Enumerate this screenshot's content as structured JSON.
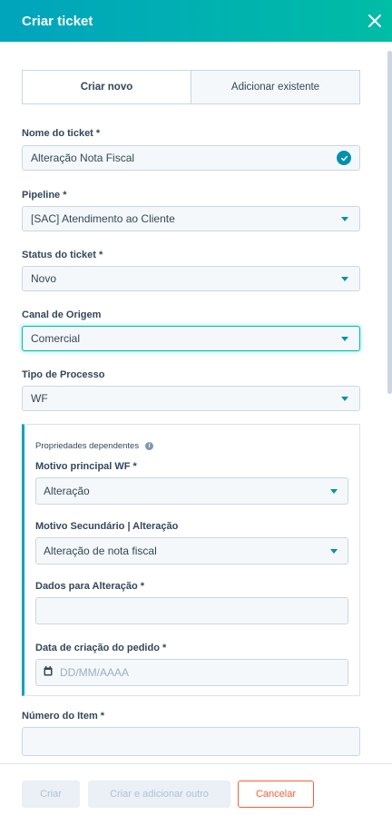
{
  "header": {
    "title": "Criar ticket",
    "close_icon": "close-icon"
  },
  "tabs": [
    {
      "label": "Criar novo",
      "active": true
    },
    {
      "label": "Adicionar existente",
      "active": false
    }
  ],
  "fields": {
    "ticket_name": {
      "label": "Nome do ticket *",
      "value": "Alteração Nota Fiscal"
    },
    "pipeline": {
      "label": "Pipeline *",
      "value": "[SAC] Atendimento ao Cliente"
    },
    "status": {
      "label": "Status do ticket *",
      "value": "Novo"
    },
    "canal": {
      "label": "Canal de Origem",
      "value": "Comercial"
    },
    "tipo": {
      "label": "Tipo de Processo",
      "value": "WF"
    },
    "numero_item": {
      "label": "Número do Item *",
      "value": ""
    }
  },
  "dependent": {
    "title": "Propriedades dependentes",
    "motivo_principal": {
      "label": "Motivo principal WF *",
      "value": "Alteração"
    },
    "motivo_secundario": {
      "label": "Motivo Secundário | Alteração",
      "value": "Alteração de nota fiscal"
    },
    "dados_alteracao": {
      "label": "Dados para Alteração *",
      "value": ""
    },
    "data_criacao": {
      "label": "Data de criação do pedido *",
      "placeholder": "DD/MM/AAAA"
    }
  },
  "footer": {
    "create_label": "Criar",
    "create_another_label": "Criar e adicionar outro",
    "cancel_label": "Cancelar"
  },
  "colors": {
    "accent": "#00a4bd",
    "cancel": "#ff5c35",
    "field_bg": "#f5f8fa"
  }
}
